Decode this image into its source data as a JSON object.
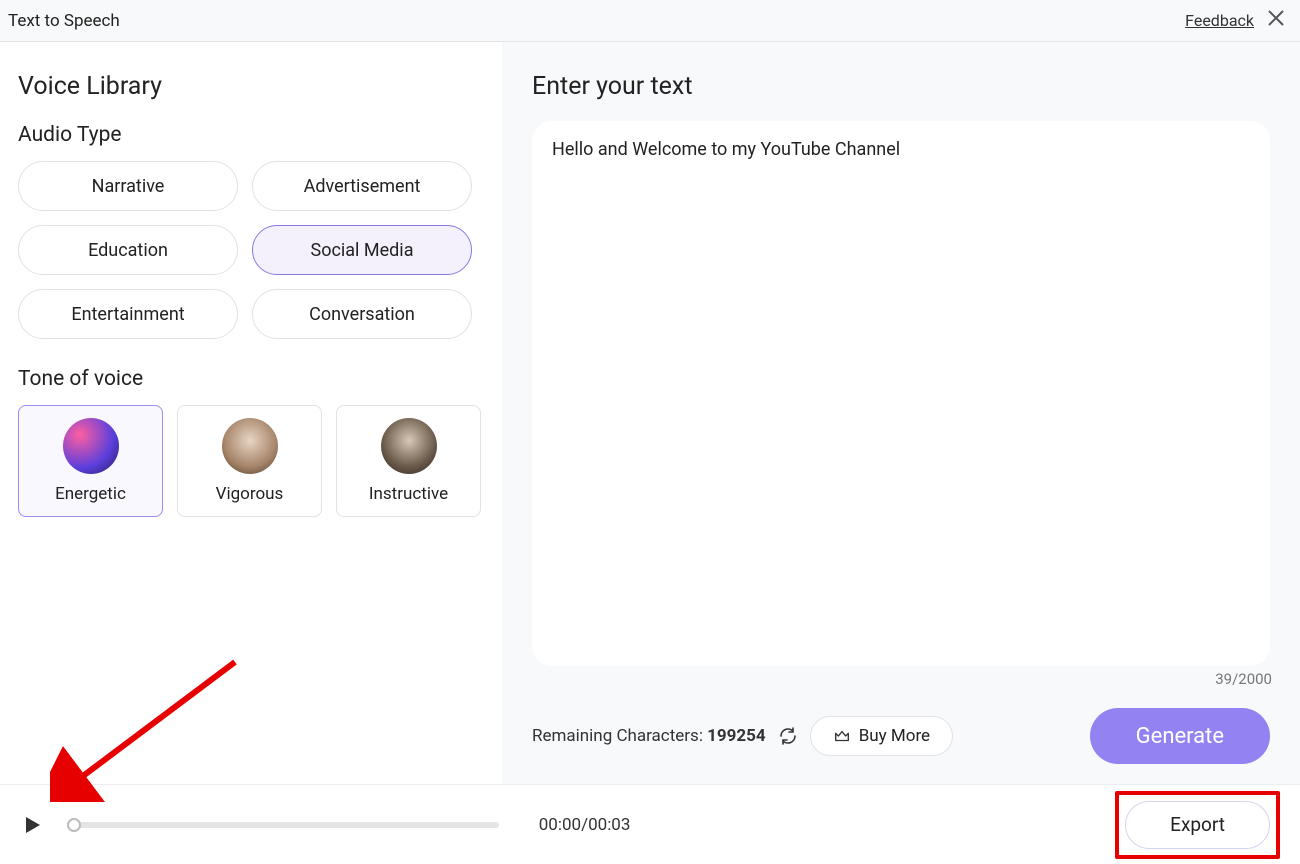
{
  "header": {
    "title": "Text to Speech",
    "feedback": "Feedback"
  },
  "sidebar": {
    "libraryTitle": "Voice Library",
    "audioTypeTitle": "Audio Type",
    "audioTypes": {
      "narrative": "Narrative",
      "advertisement": "Advertisement",
      "education": "Education",
      "socialMedia": "Social Media",
      "entertainment": "Entertainment",
      "conversation": "Conversation"
    },
    "toneTitle": "Tone of voice",
    "tones": {
      "energetic": "Energetic",
      "vigorous": "Vigorous",
      "instructive": "Instructive"
    }
  },
  "main": {
    "title": "Enter your text",
    "textValue": "Hello and Welcome to my YouTube Channel",
    "charCounter": "39/2000",
    "remainingLabel": "Remaining Characters: ",
    "remainingValue": "199254",
    "buyMore": "Buy More",
    "generate": "Generate"
  },
  "player": {
    "time": "00:00/00:03",
    "export": "Export"
  }
}
